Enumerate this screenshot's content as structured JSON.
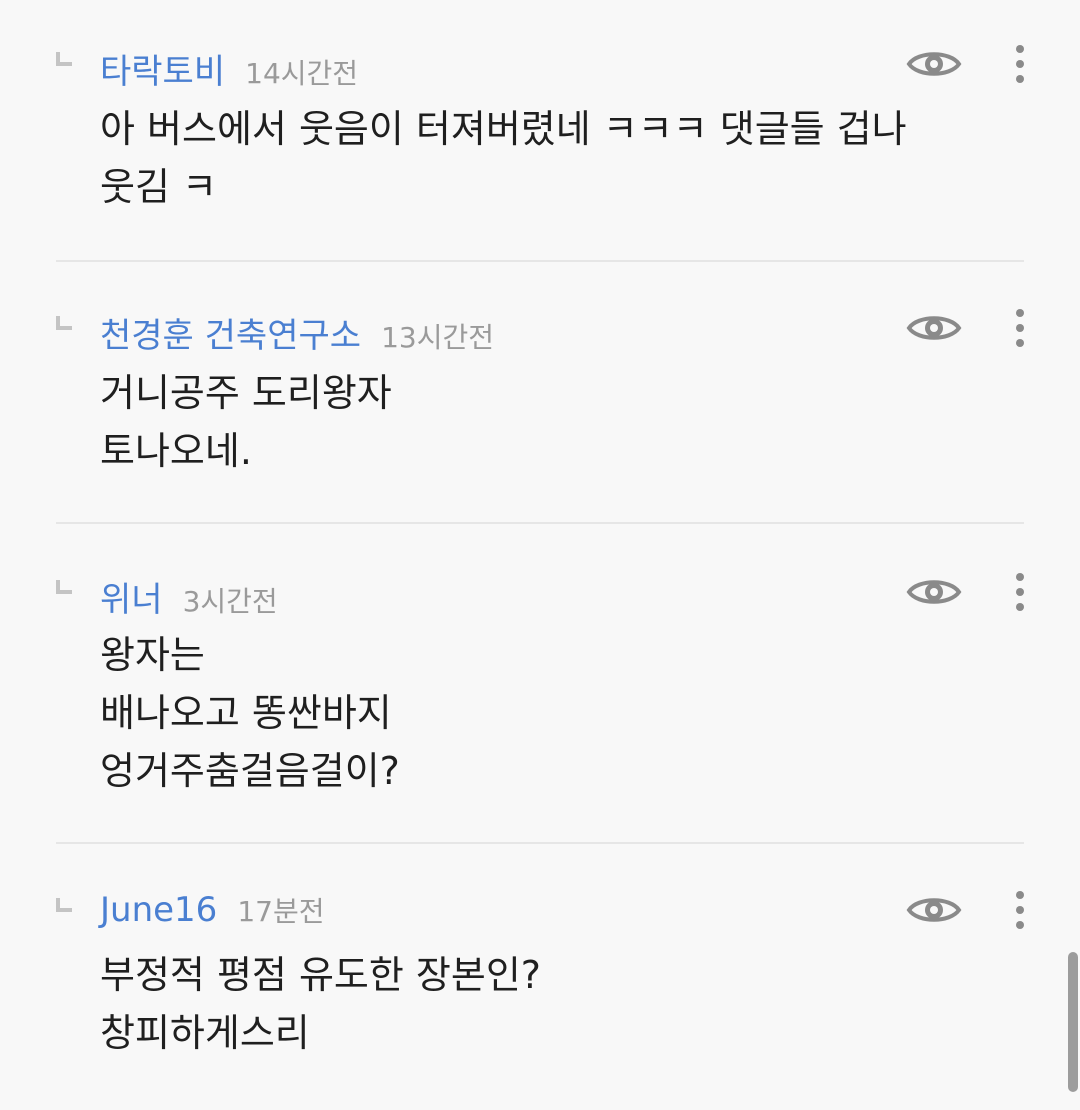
{
  "comments": [
    {
      "author": "타락토비",
      "time": "14시간전",
      "lines": [
        "아 버스에서 웃음이 터져버렸네 ㅋㅋㅋ 댓글들 겁나",
        "웃김 ㅋ"
      ]
    },
    {
      "author": "천경훈 건축연구소",
      "time": "13시간전",
      "lines": [
        "거니공주 도리왕자",
        "토나오네."
      ]
    },
    {
      "author": "위너",
      "time": "3시간전",
      "lines": [
        "왕자는",
        "배나오고 똥싼바지",
        "엉거주춤걸음걸이?"
      ]
    },
    {
      "author": "June16",
      "time": "17분전",
      "lines": [
        "부정적 평점 유도한 장본인?",
        "창피하게스리"
      ]
    }
  ],
  "icons": {
    "view": "eye-icon",
    "more": "more-vertical-icon",
    "reply": "reply-indicator-icon"
  },
  "colors": {
    "author": "#4a7fd1",
    "time": "#9a9a9a",
    "body": "#1f1f1f",
    "icon": "#8a8a8a",
    "background": "#f8f8f8"
  }
}
